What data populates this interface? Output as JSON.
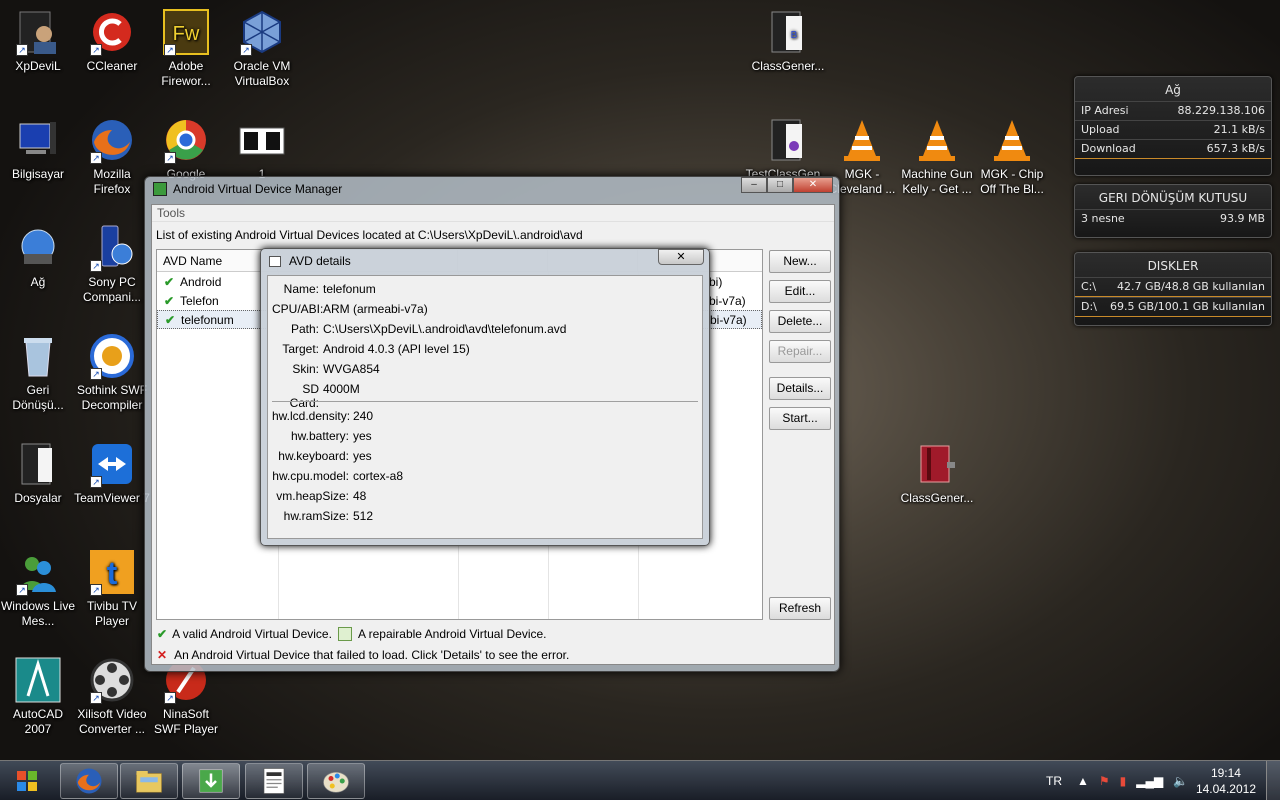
{
  "desktop_icons": [
    {
      "label": "XpDeviL",
      "icon": "user-folder-icon"
    },
    {
      "label": "CCleaner",
      "icon": "ccleaner-icon"
    },
    {
      "label": "Adobe Firewor...",
      "icon": "adobe-fireworks-icon"
    },
    {
      "label": "Oracle VM VirtualBox",
      "icon": "virtualbox-icon"
    },
    {
      "label": "Bilgisayar",
      "icon": "computer-icon"
    },
    {
      "label": "Mozilla Firefox",
      "icon": "firefox-icon"
    },
    {
      "label": "Google",
      "icon": "chrome-icon"
    },
    {
      "label": "1",
      "icon": "image-file-icon"
    },
    {
      "label": "Ağ",
      "icon": "network-icon"
    },
    {
      "label": "Sony PC Compani...",
      "icon": "sony-pc-companion-icon"
    },
    {
      "label": "Geri Dönüşü...",
      "icon": "recycle-bin-icon"
    },
    {
      "label": "Sothink SWF Decompiler",
      "icon": "sothink-icon"
    },
    {
      "label": "Dosyalar",
      "icon": "folder-icon"
    },
    {
      "label": "TeamViewer 7",
      "icon": "teamviewer-icon"
    },
    {
      "label": "Windows Live Mes...",
      "icon": "messenger-icon"
    },
    {
      "label": "Tivibu TV Player",
      "icon": "tivibu-icon"
    },
    {
      "label": "AutoCAD 2007",
      "icon": "autocad-icon"
    },
    {
      "label": "Xilisoft Video Converter ...",
      "icon": "xilisoft-icon"
    },
    {
      "label": "NinaSoft SWF Player",
      "icon": "ninasoft-icon"
    },
    {
      "label": "ClassGener...",
      "icon": "class-generator-icon"
    },
    {
      "label": "TestClassGen...",
      "icon": "class-generator-icon"
    },
    {
      "label": "MGK - Cleveland ...",
      "icon": "vlc-icon"
    },
    {
      "label": "Machine Gun Kelly - Get ...",
      "icon": "vlc-icon"
    },
    {
      "label": "MGK - Chip Off The Bl...",
      "icon": "vlc-icon"
    },
    {
      "label": "ClassGener...",
      "icon": "winrar-icon"
    }
  ],
  "gadgets": {
    "network": {
      "title": "Ağ",
      "rows": [
        {
          "label": "IP Adresi",
          "value": "88.229.138.106"
        },
        {
          "label": "Upload",
          "value": "21.1 kB/s"
        },
        {
          "label": "Download",
          "value": "657.3 kB/s"
        }
      ]
    },
    "recycle": {
      "title": "GERI DÖNÜŞÜM KUTUSU",
      "count": "3 nesne",
      "size": "93.9 MB"
    },
    "disks": {
      "title": "DISKLER",
      "rows": [
        {
          "drive": "C:\\",
          "usage": "42.7 GB/48.8 GB kullanılan"
        },
        {
          "drive": "D:\\",
          "usage": "69.5 GB/100.1 GB kullanılan"
        }
      ]
    }
  },
  "avd_manager": {
    "title": "Android Virtual Device Manager",
    "menu": "Tools",
    "location": "List of existing Android Virtual Devices located at C:\\Users\\XpDeviL\\.android\\avd",
    "columns": {
      "name": "AVD Name"
    },
    "rows": [
      {
        "name": "Android",
        "abi": "bi)"
      },
      {
        "name": "Telefon",
        "abi": "bi-v7a)"
      },
      {
        "name": "telefonum",
        "abi": "bi-v7a)"
      }
    ],
    "buttons": {
      "new": "New...",
      "edit": "Edit...",
      "delete": "Delete...",
      "repair": "Repair...",
      "details": "Details...",
      "start": "Start...",
      "refresh": "Refresh"
    },
    "legend": {
      "valid": "A valid Android Virtual Device.",
      "repairable": "A repairable Android Virtual Device.",
      "failed": "An Android Virtual Device that failed to load. Click 'Details' to see the error."
    }
  },
  "avd_details": {
    "title": "AVD details",
    "fields": [
      {
        "key": "Name:",
        "value": "telefonum"
      },
      {
        "key": "CPU/ABI:",
        "value": "ARM (armeabi-v7a)"
      },
      {
        "key": "Path:",
        "value": "C:\\Users\\XpDeviL\\.android\\avd\\telefonum.avd"
      },
      {
        "key": "Target:",
        "value": "Android 4.0.3 (API level 15)"
      },
      {
        "key": "Skin:",
        "value": "WVGA854"
      },
      {
        "key": "SD Card:",
        "value": "4000M"
      }
    ],
    "hw": [
      {
        "key": "hw.lcd.density:",
        "value": "240"
      },
      {
        "key": "hw.battery:",
        "value": "yes"
      },
      {
        "key": "hw.keyboard:",
        "value": "yes"
      },
      {
        "key": "hw.cpu.model:",
        "value": "cortex-a8"
      },
      {
        "key": "vm.heapSize:",
        "value": "48"
      },
      {
        "key": "hw.ramSize:",
        "value": "512"
      }
    ]
  },
  "taskbar": {
    "items": [
      "firefox-icon",
      "explorer-icon",
      "avd-manager-icon",
      "notepad-icon",
      "paint-icon"
    ],
    "language": "TR",
    "time": "19:14",
    "date": "14.04.2012"
  }
}
